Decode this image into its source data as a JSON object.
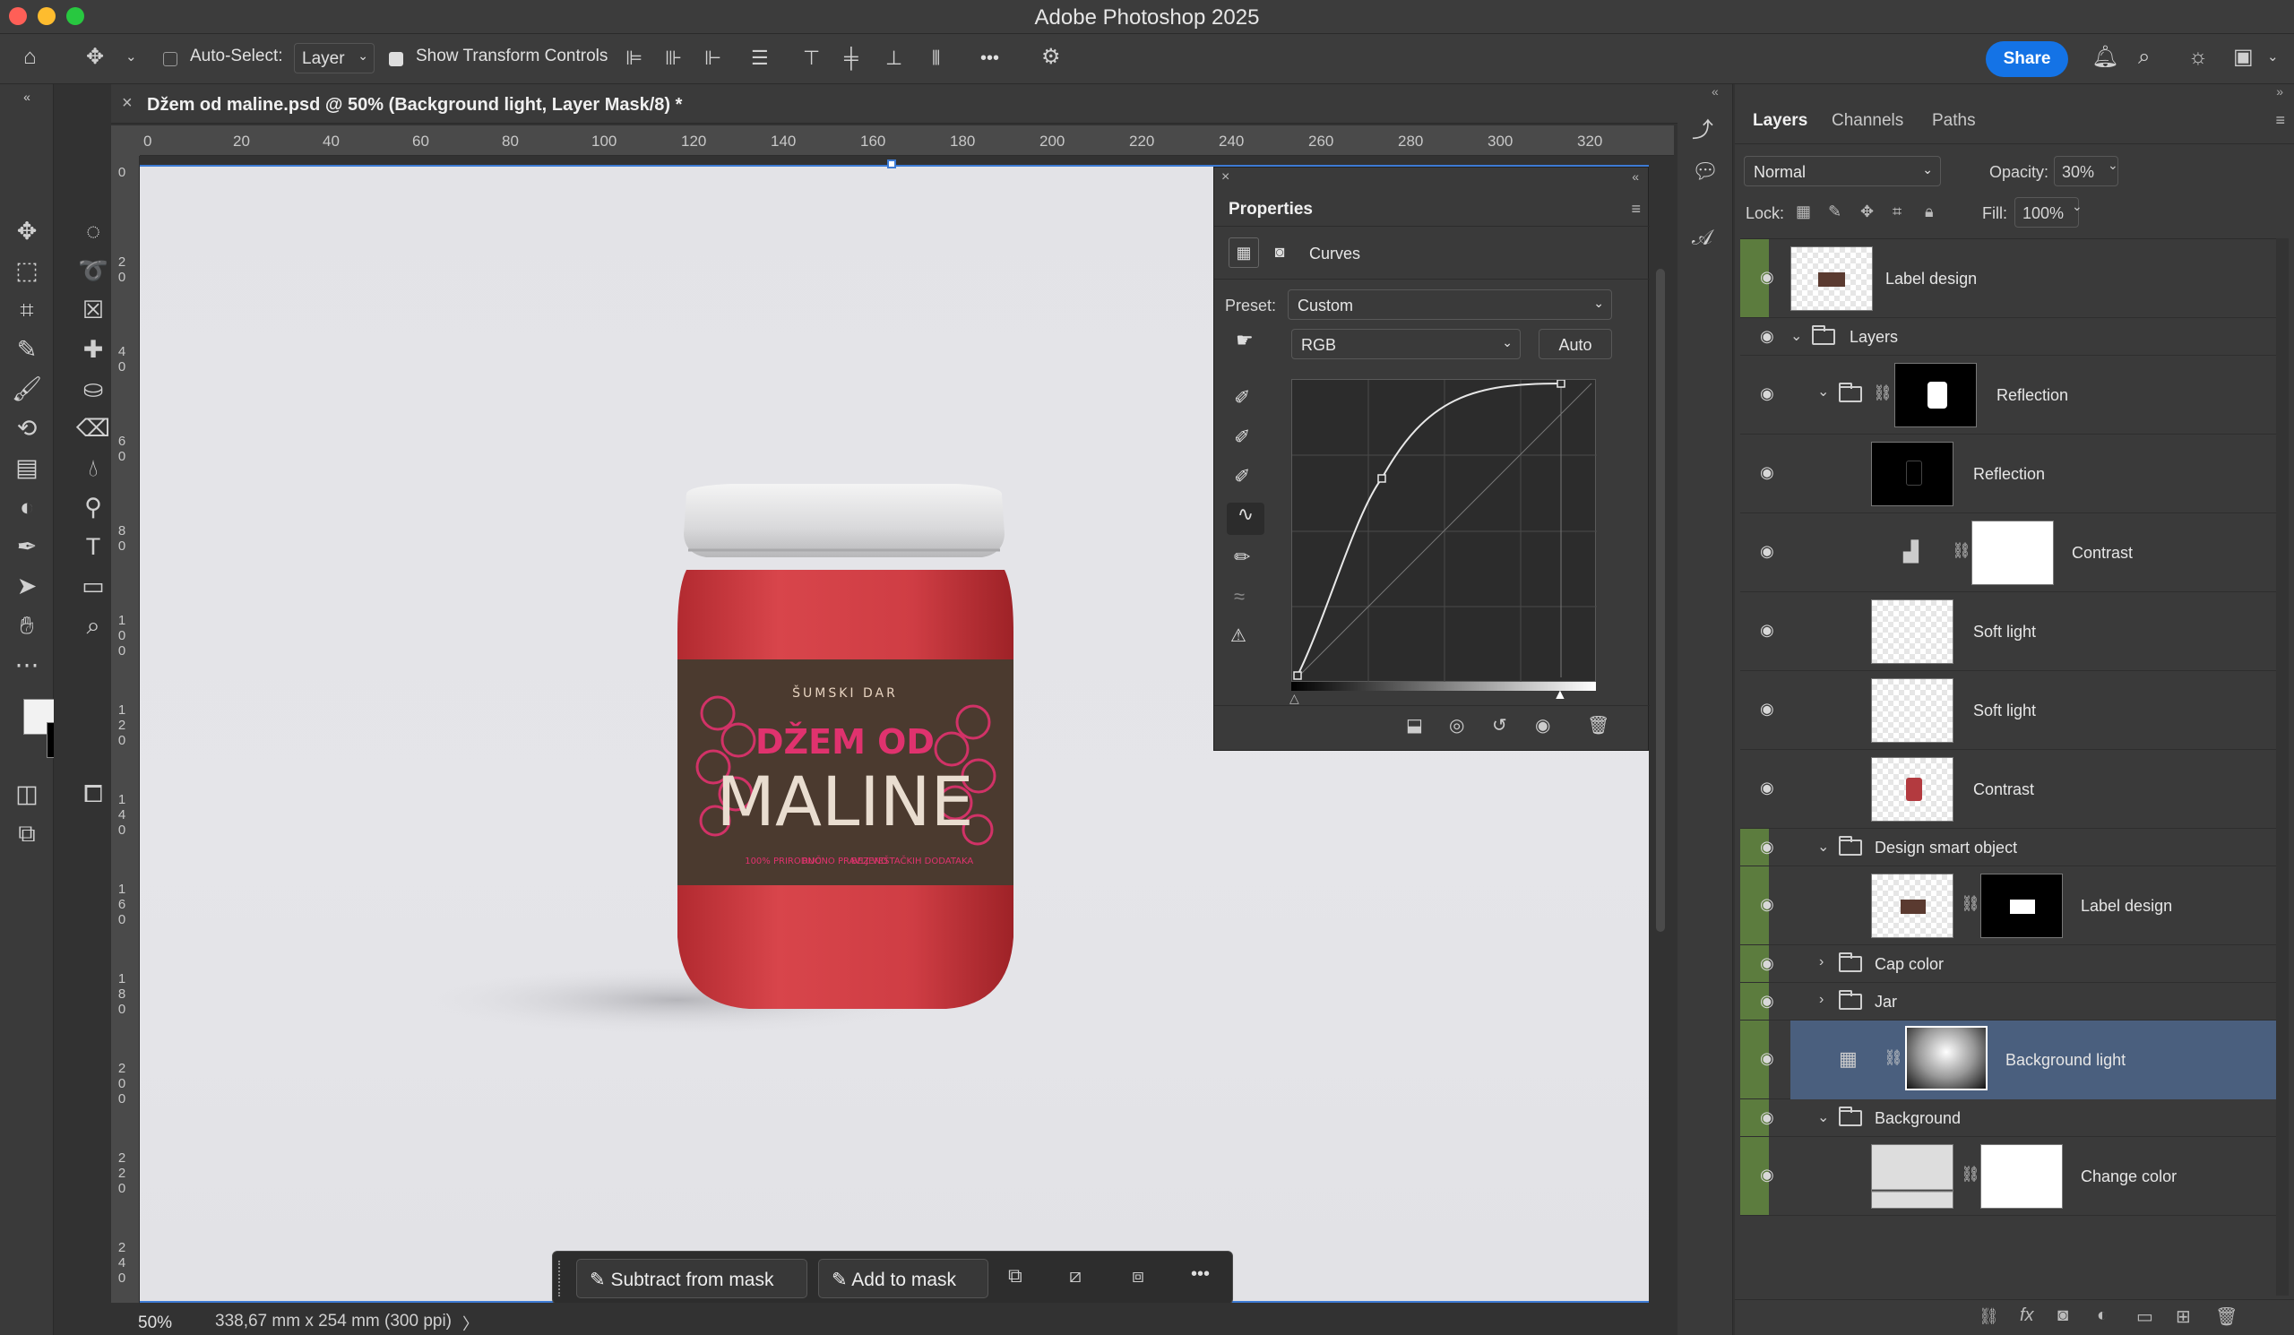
{
  "window": {
    "title": "Adobe Photoshop 2025"
  },
  "options_bar": {
    "auto_select_label": "Auto-Select:",
    "auto_select_value": "Layer",
    "show_transform_label": "Show Transform Controls",
    "more_label": "•••",
    "share_label": "Share"
  },
  "document": {
    "tab_title": "Džem od maline.psd @ 50% (Background light, Layer Mask/8) *",
    "close_label": "×",
    "ruler_top": [
      "0",
      "20",
      "40",
      "60",
      "80",
      "100",
      "120",
      "140",
      "160",
      "180",
      "200",
      "220",
      "240",
      "260",
      "280",
      "300",
      "320"
    ],
    "ruler_left": [
      "0",
      "20",
      "40",
      "60",
      "80",
      "100",
      "120",
      "140",
      "160",
      "180",
      "200",
      "220",
      "240"
    ]
  },
  "status": {
    "zoom": "50%",
    "doc_info": "338,67 mm x 254 mm (300 ppi)",
    "arrow": "〉"
  },
  "mask_bar": {
    "subtract_label": "Subtract from mask",
    "add_label": "Add to mask",
    "more_label": "•••"
  },
  "jar": {
    "brand": "ŠUMSKI DAR",
    "title_line1": "DŽEM OD",
    "title_line2": "MALINE",
    "claims": [
      "100% PRIRODNO",
      "RUČNO PRAVLJENO",
      "BEZ VEŠTAČKIH DODATAKA"
    ]
  },
  "properties": {
    "title": "Properties",
    "adjustment": "Curves",
    "preset_label": "Preset:",
    "preset_value": "Custom",
    "channel_value": "RGB",
    "auto_label": "Auto"
  },
  "layers_panel": {
    "tabs": [
      "Layers",
      "Channels",
      "Paths"
    ],
    "blend_mode": "Normal",
    "opacity_label": "Opacity:",
    "opacity_value": "30%",
    "lock_label": "Lock:",
    "fill_label": "Fill:",
    "fill_value": "100%",
    "layers": [
      {
        "name": "Label design"
      },
      {
        "name": "Layers"
      },
      {
        "name": "Reflection"
      },
      {
        "name": "Reflection"
      },
      {
        "name": "Contrast"
      },
      {
        "name": "Soft light"
      },
      {
        "name": "Soft light"
      },
      {
        "name": "Contrast"
      },
      {
        "name": "Design smart object"
      },
      {
        "name": "Label design"
      },
      {
        "name": "Cap color"
      },
      {
        "name": "Jar"
      },
      {
        "name": "Background light"
      },
      {
        "name": "Background"
      },
      {
        "name": "Change color"
      }
    ],
    "footer_fx": "fx"
  },
  "colors": {
    "accent": "#1473e6",
    "selected_row": "#4a5f7e",
    "visibility_green": "#5c7c3e",
    "jar_red": "#c8343a",
    "label_brown": "#4b3a2f",
    "label_pink": "#e0326e"
  }
}
